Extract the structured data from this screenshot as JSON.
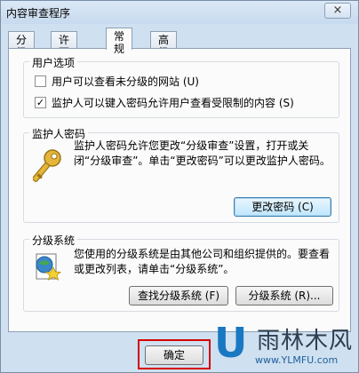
{
  "window": {
    "title": "内容审查程序",
    "close_glyph": "×"
  },
  "tabs": [
    {
      "label": "分级",
      "active": false
    },
    {
      "label": "许可站点",
      "active": false
    },
    {
      "label": "常规",
      "active": true
    },
    {
      "label": "高级",
      "active": false
    }
  ],
  "user_options": {
    "title": "用户选项",
    "items": [
      {
        "label": "用户可以查看未分级的网站 (U)",
        "checked": false
      },
      {
        "label": "监护人可以键入密码允许用户查看受限制的内容 (S)",
        "checked": true
      }
    ]
  },
  "supervisor_password": {
    "title": "监护人密码",
    "description": "监护人密码允许您更改“分级审查”设置，打开或关闭“分级审查”。单击“更改密码”可以更改监护人密码。",
    "change_button": "更改密码 (C)"
  },
  "rating_systems": {
    "title": "分级系统",
    "description": "您使用的分级系统是由其他公司和组织提供的。要查看或更改列表，请单击“分级系统”。",
    "find_button": "查找分级系统 (F)",
    "systems_button": "分级系统 (R)..."
  },
  "footer": {
    "ok_label": "确定"
  },
  "watermark": {
    "logo_letter": "U",
    "name": "雨林木风",
    "url": "www.YLMFU.com"
  },
  "colors": {
    "highlight_border": "#d40000",
    "window_frame": "#cfe0f1"
  }
}
